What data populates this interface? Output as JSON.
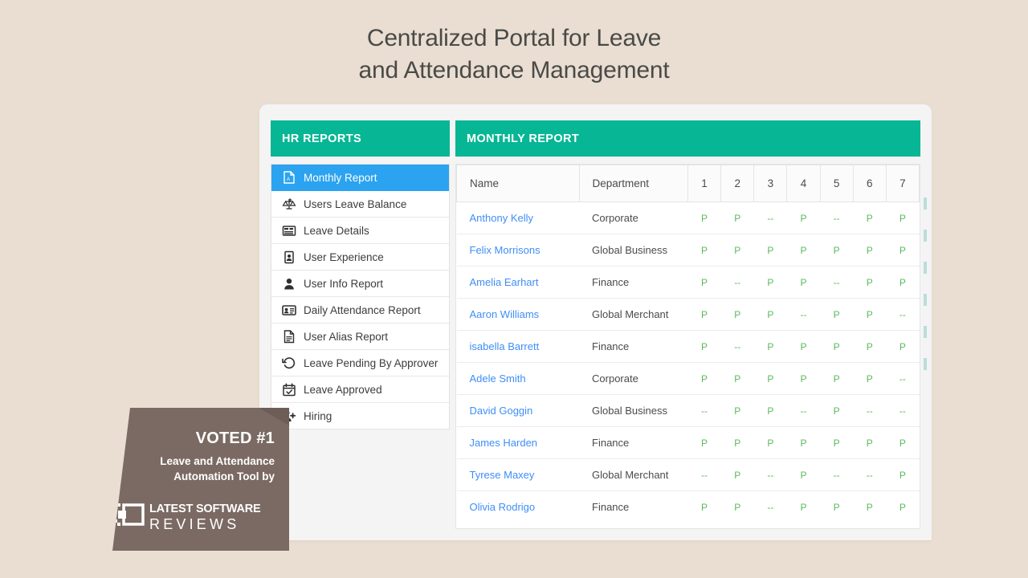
{
  "headline": {
    "line1": "Centralized Portal for Leave",
    "line2": "and Attendance Management"
  },
  "colors": {
    "background": "#e9ded1",
    "panel": "#f4f4f4",
    "teal_header": "#06b694",
    "active_blue": "#2ba3f0",
    "present_green": "#5cb85c",
    "link_blue": "#3f8ef7",
    "ribbon_brown": "#7b6a63"
  },
  "sidebar": {
    "header": "HR REPORTS",
    "items": [
      {
        "label": "Monthly Report",
        "icon": "pdf-file-icon",
        "active": true
      },
      {
        "label": "Users Leave Balance",
        "icon": "balance-scale-icon",
        "active": false
      },
      {
        "label": "Leave Details",
        "icon": "table-icon",
        "active": false
      },
      {
        "label": "User Experience",
        "icon": "id-badge-icon",
        "active": false
      },
      {
        "label": "User Info Report",
        "icon": "person-icon",
        "active": false
      },
      {
        "label": "Daily Attendance Report",
        "icon": "contact-card-icon",
        "active": false
      },
      {
        "label": "User Alias Report",
        "icon": "document-icon",
        "active": false
      },
      {
        "label": "Leave Pending By Approver",
        "icon": "history-icon",
        "active": false
      },
      {
        "label": "Leave Approved",
        "icon": "calendar-check-icon",
        "active": false
      },
      {
        "label": "Hiring",
        "icon": "hiring-icon",
        "active": false
      }
    ]
  },
  "main": {
    "header": "MONTHLY REPORT",
    "table": {
      "columns": [
        "Name",
        "Department",
        "1",
        "2",
        "3",
        "4",
        "5",
        "6",
        "7"
      ],
      "rows": [
        {
          "name": "Anthony Kelly",
          "department": "Corporate",
          "days": [
            "P",
            "P",
            "--",
            "P",
            "--",
            "P",
            "P"
          ]
        },
        {
          "name": "Felix Morrisons",
          "department": "Global Business",
          "days": [
            "P",
            "P",
            "P",
            "P",
            "P",
            "P",
            "P"
          ]
        },
        {
          "name": "Amelia Earhart",
          "department": "Finance",
          "days": [
            "P",
            "--",
            "P",
            "P",
            "--",
            "P",
            "P"
          ]
        },
        {
          "name": "Aaron Williams",
          "department": "Global Merchant",
          "days": [
            "P",
            "P",
            "P",
            "--",
            "P",
            "P",
            "--"
          ]
        },
        {
          "name": "isabella Barrett",
          "department": "Finance",
          "days": [
            "P",
            "--",
            "P",
            "P",
            "P",
            "P",
            "P"
          ]
        },
        {
          "name": "Adele Smith",
          "department": "Corporate",
          "days": [
            "P",
            "P",
            "P",
            "P",
            "P",
            "P",
            "--"
          ]
        },
        {
          "name": "David Goggin",
          "department": "Global Business",
          "days": [
            "--",
            "P",
            "P",
            "--",
            "P",
            "--",
            "--"
          ]
        },
        {
          "name": "James Harden",
          "department": "Finance",
          "days": [
            "P",
            "P",
            "P",
            "P",
            "P",
            "P",
            "P"
          ]
        },
        {
          "name": "Tyrese Maxey",
          "department": "Global Merchant",
          "days": [
            "--",
            "P",
            "--",
            "P",
            "--",
            "--",
            "P"
          ]
        },
        {
          "name": "Olivia Rodrigo",
          "department": "Finance",
          "days": [
            "P",
            "P",
            "--",
            "P",
            "P",
            "P",
            "P"
          ]
        }
      ]
    }
  },
  "ribbon": {
    "voted": "VOTED #1",
    "subtitle_line1": "Leave and Attendance",
    "subtitle_line2": "Automation Tool by",
    "logo_line1": "LATEST SOFTWARE",
    "logo_line2": "REVIEWS"
  }
}
